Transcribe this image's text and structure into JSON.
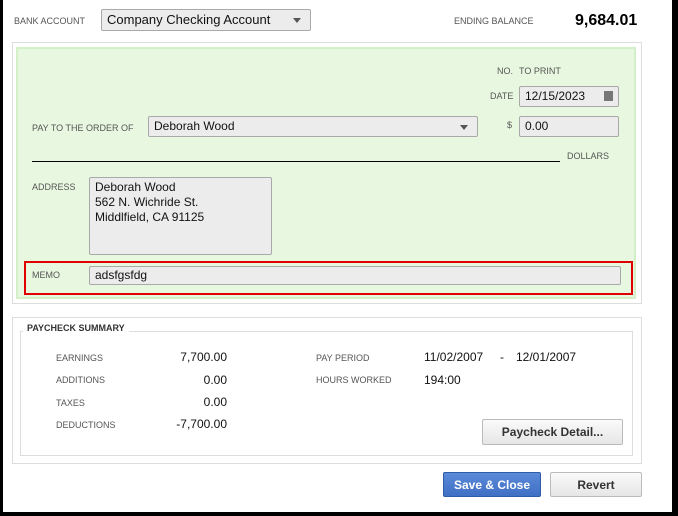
{
  "header": {
    "bank_account_label": "BANK ACCOUNT",
    "bank_account": "Company Checking Account",
    "ending_balance_label": "ENDING BALANCE",
    "ending_balance": "9,684.01"
  },
  "check": {
    "no_label": "NO.",
    "no_value": "TO PRINT",
    "date_label": "DATE",
    "date": "12/15/2023",
    "pay_to_label": "PAY TO THE ORDER OF",
    "payee": "Deborah Wood",
    "dollar_sign": "$",
    "amount": "0.00",
    "dollars_label": "DOLLARS",
    "address_label": "ADDRESS",
    "address": [
      "Deborah Wood",
      "562 N. Wichride St.",
      "Middlfield, CA 91125"
    ],
    "memo_label": "MEMO",
    "memo": "adsfgsfdg",
    "memo_highlight_color": "#e00000",
    "check_bg_color": "#e8f8e0"
  },
  "summary": {
    "title": "PAYCHECK SUMMARY",
    "rows": [
      {
        "label": "EARNINGS",
        "value": "7,700.00"
      },
      {
        "label": "ADDITIONS",
        "value": "0.00"
      },
      {
        "label": "TAXES",
        "value": "0.00"
      },
      {
        "label": "DEDUCTIONS",
        "value": "-7,700.00"
      }
    ],
    "pay_period_label": "PAY PERIOD",
    "pay_period_start": "11/02/2007",
    "pay_period_sep": "-",
    "pay_period_end": "12/01/2007",
    "hours_label": "HOURS WORKED",
    "hours": "194:00",
    "detail_button": "Paycheck Detail..."
  },
  "footer": {
    "save_close": "Save & Close",
    "revert": "Revert",
    "primary_color": "#3f6fc4"
  }
}
